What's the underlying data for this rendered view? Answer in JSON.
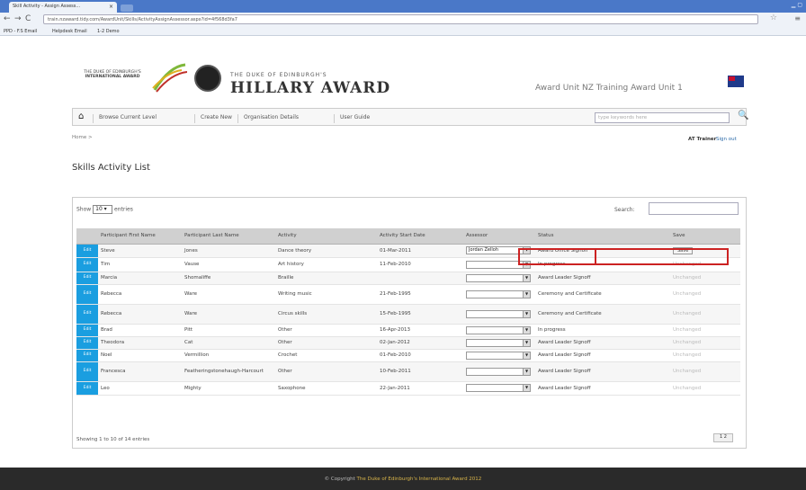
{
  "browser": {
    "tab_title": "Skill Activity - Assign Assess...",
    "url": "train.nzaward.tidy.com/AwardUnit/Skills/ActivityAssignAssessor.aspx?id=4f568d3fa7",
    "bookmarks": [
      "PPD - F.S Email",
      "Helpdesk Email",
      "1-2 Demo"
    ]
  },
  "header": {
    "left_logo_top": "THE DUKE OF EDINBURGH'S",
    "left_logo_bottom": "INTERNATIONAL AWARD",
    "hillary_small": "THE DUKE OF EDINBURGH'S",
    "hillary_big": "HILLARY AWARD",
    "award_unit": "Award Unit NZ Training Award Unit 1"
  },
  "nav": {
    "items": [
      "Browse Current Level",
      "Create New",
      "Organisation Details",
      "User Guide"
    ],
    "search_placeholder": "type keywords here"
  },
  "breadcrumb": "Home >",
  "user": {
    "name": "AT Trainer",
    "signout": "Sign out"
  },
  "page_title": "Skills Activity List",
  "table_controls": {
    "show_label": "Show",
    "length_value": "10",
    "entries_label": "entries",
    "search_label": "Search:",
    "info": "Showing 1 to 10 of 14 entries",
    "pager": "1 2"
  },
  "columns": [
    "",
    "Participant First Name",
    "Participant Last Name",
    "Activity",
    "Activity Start Date",
    "Assessor",
    "Status",
    "Save"
  ],
  "rows": [
    {
      "edit": "Edit",
      "first": "Steve",
      "last": "Jones",
      "activity": "Dance theory",
      "date": "01-Mar-2011",
      "assessor": "Jordan Zelloh",
      "status": "Award Office Signoff",
      "save": "Save"
    },
    {
      "edit": "Edit",
      "first": "Tim",
      "last": "Vause",
      "activity": "Art history",
      "date": "11-Feb-2010",
      "assessor": "",
      "status": "In progress",
      "save": "Unchanged"
    },
    {
      "edit": "Edit",
      "first": "Marcia",
      "last": "Shomaliffe",
      "activity": "Braille",
      "date": "",
      "assessor": "",
      "status": "Award Leader Signoff",
      "save": "Unchanged"
    },
    {
      "edit": "Edit",
      "first": "Rebecca",
      "last": "Ware",
      "activity": "Writing music",
      "date": "21-Feb-1995",
      "assessor": "",
      "status": "Ceremony and Certificate",
      "save": "Unchanged"
    },
    {
      "edit": "Edit",
      "first": "Rebecca",
      "last": "Ware",
      "activity": "Circus skills",
      "date": "15-Feb-1995",
      "assessor": "",
      "status": "Ceremony and Certificate",
      "save": "Unchanged"
    },
    {
      "edit": "Edit",
      "first": "Brad",
      "last": "Pitt",
      "activity": "Other",
      "date": "16-Apr-2013",
      "assessor": "",
      "status": "In progress",
      "save": "Unchanged"
    },
    {
      "edit": "Edit",
      "first": "Theodora",
      "last": "Cat",
      "activity": "Other",
      "date": "02-Jan-2012",
      "assessor": "",
      "status": "Award Leader Signoff",
      "save": "Unchanged"
    },
    {
      "edit": "Edit",
      "first": "Noel",
      "last": "Vermillion",
      "activity": "Crochet",
      "date": "01-Feb-2010",
      "assessor": "",
      "status": "Award Leader Signoff",
      "save": "Unchanged"
    },
    {
      "edit": "Edit",
      "first": "Francesca",
      "last": "Featheringstonehaugh-Harcourt",
      "activity": "Other",
      "date": "10-Feb-2011",
      "assessor": "",
      "status": "Award Leader Signoff",
      "save": "Unchanged"
    },
    {
      "edit": "Edit",
      "first": "Leo",
      "last": "Mighty",
      "activity": "Saxophone",
      "date": "22-Jan-2011",
      "assessor": "",
      "status": "Award Leader Signoff",
      "save": "Unchanged"
    }
  ],
  "footer": {
    "prefix": "© Copyright",
    "link": "The Duke of Edinburgh's International Award 2012"
  },
  "colors": {
    "edit_blue": "#1a9ee0",
    "highlight_red": "#cc2222",
    "footer_bg": "#2a2a2a"
  }
}
